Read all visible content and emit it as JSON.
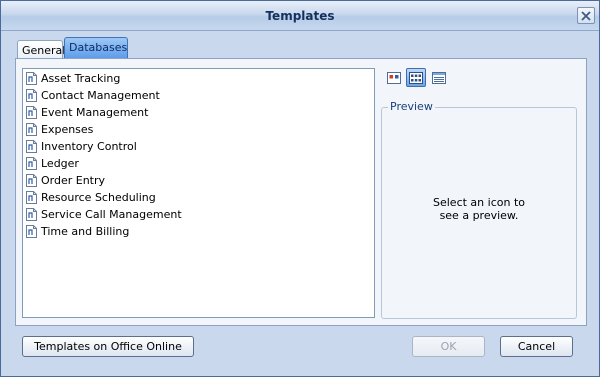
{
  "window": {
    "title": "Templates"
  },
  "tabs": [
    {
      "label": "General",
      "selected": false
    },
    {
      "label": "Databases",
      "selected": true
    }
  ],
  "templates": [
    {
      "label": "Asset Tracking",
      "icon": "document-icon"
    },
    {
      "label": "Contact Management",
      "icon": "document-icon"
    },
    {
      "label": "Event Management",
      "icon": "document-icon"
    },
    {
      "label": "Expenses",
      "icon": "document-icon"
    },
    {
      "label": "Inventory Control",
      "icon": "document-icon"
    },
    {
      "label": "Ledger",
      "icon": "document-icon"
    },
    {
      "label": "Order Entry",
      "icon": "document-icon"
    },
    {
      "label": "Resource Scheduling",
      "icon": "document-icon"
    },
    {
      "label": "Service Call Management",
      "icon": "document-icon"
    },
    {
      "label": "Time and Billing",
      "icon": "document-icon"
    }
  ],
  "view_options": [
    {
      "icon": "large-icons-view-icon",
      "selected": false
    },
    {
      "icon": "list-view-icon",
      "selected": true
    },
    {
      "icon": "details-view-icon",
      "selected": false
    }
  ],
  "preview": {
    "legend": "Preview",
    "message_line1": "Select an icon to",
    "message_line2": "see a preview."
  },
  "buttons": {
    "online": "Templates on Office Online",
    "ok": "OK",
    "ok_enabled": false,
    "cancel": "Cancel"
  },
  "colors": {
    "accent": "#5b9bea",
    "frame": "#c9d8ed"
  }
}
